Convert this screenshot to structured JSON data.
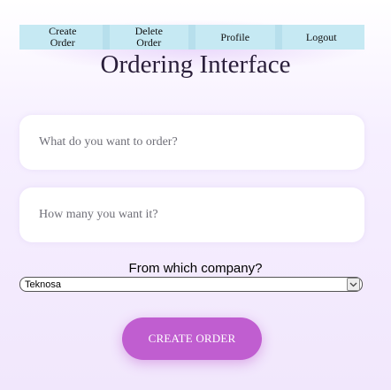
{
  "nav": {
    "items": [
      {
        "label": "Create\nOrder"
      },
      {
        "label": "Delete\nOrder"
      },
      {
        "label": "Profile"
      },
      {
        "label": "Logout"
      }
    ]
  },
  "page": {
    "title": "Ordering Interface"
  },
  "form": {
    "item": {
      "value": "",
      "placeholder": "What do you want to order?"
    },
    "quantity": {
      "value": "",
      "placeholder": "How many you want it?"
    },
    "company": {
      "label": "From which company?",
      "selected": "Teknosa"
    },
    "submit_label": "CREATE ORDER"
  },
  "colors": {
    "nav_bg": "#c6e9f3",
    "accent": "#c05ed0"
  }
}
